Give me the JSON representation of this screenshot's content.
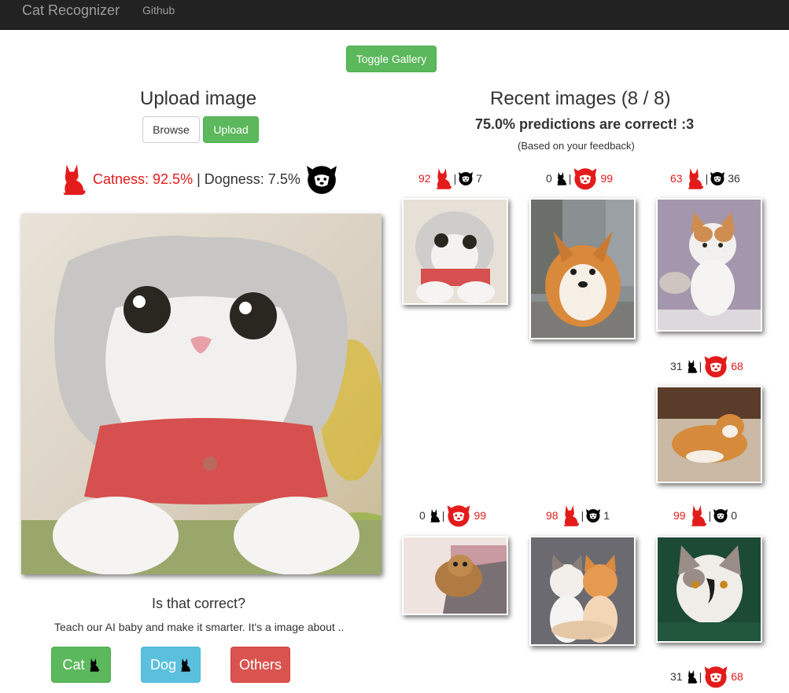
{
  "navbar": {
    "brand": "Cat Recognizer",
    "github": "Github"
  },
  "toggle_label": "Toggle Gallery",
  "upload": {
    "title": "Upload image",
    "browse_label": "Browse",
    "upload_label": "Upload",
    "catness": "Catness: 92.5%",
    "separator": " | ",
    "dogness": "Dogness: 7.5%"
  },
  "feedback": {
    "question": "Is that correct?",
    "teach": "Teach our AI baby and make it smarter. It's a image about ..",
    "cat_label": "Cat",
    "dog_label": "Dog",
    "others_label": "Others"
  },
  "recent": {
    "title": "Recent images (8 / 8)",
    "accuracy": "75.0% predictions are correct! :3",
    "note": "(Based on your feedback)",
    "items": [
      {
        "cat": "92",
        "dog": "7",
        "winner": "cat"
      },
      {
        "cat": "0",
        "dog": "99",
        "winner": "dog"
      },
      {
        "cat": "63",
        "dog": "36",
        "winner": "cat"
      },
      {
        "cat": "31",
        "dog": "68",
        "winner": "dog"
      },
      {
        "cat": "0",
        "dog": "99",
        "winner": "dog"
      },
      {
        "cat": "98",
        "dog": "1",
        "winner": "cat"
      },
      {
        "cat": "99",
        "dog": "0",
        "winner": "cat"
      },
      {
        "cat": "31",
        "dog": "68",
        "winner": "dog"
      }
    ]
  },
  "colors": {
    "navbar": "#222222",
    "success": "#5cb85c",
    "info": "#5bc0de",
    "danger": "#d9534f",
    "highlight": "#e41b1b"
  }
}
